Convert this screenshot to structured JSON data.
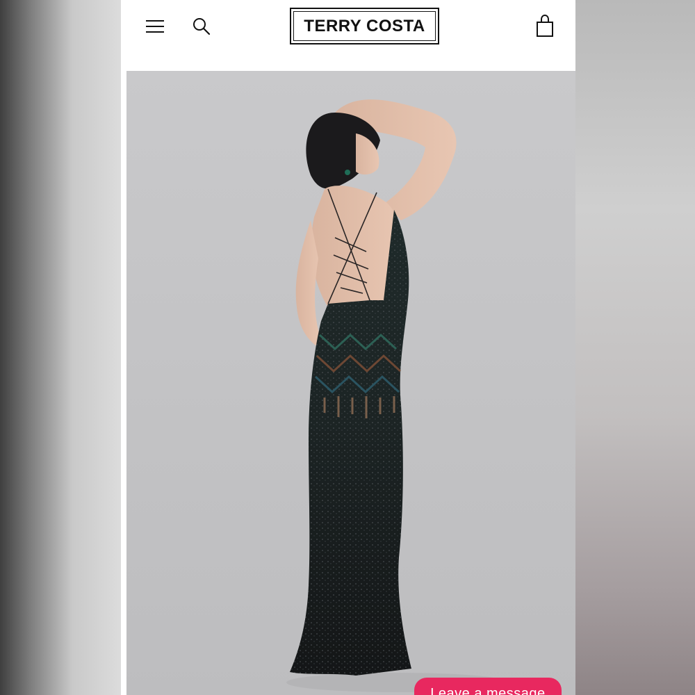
{
  "header": {
    "brand": "TERRY COSTA",
    "menu_icon": "hamburger-menu-icon",
    "search_icon": "search-icon",
    "cart_icon": "shopping-bag-icon"
  },
  "product_image": {
    "subject": "model in black beaded gown with lace-up open back"
  },
  "chat": {
    "button_label": "Leave a message",
    "color": "#e8285f"
  }
}
